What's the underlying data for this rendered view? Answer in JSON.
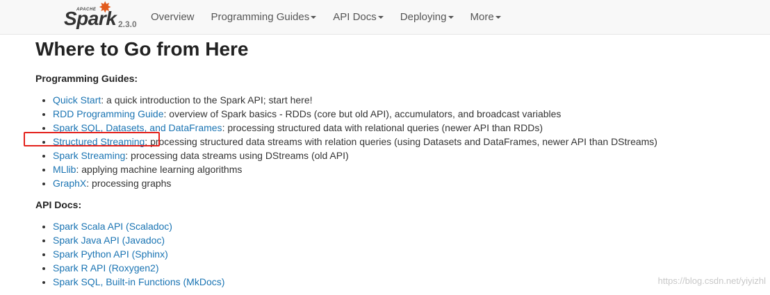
{
  "brand": {
    "apache": "APACHE",
    "name": "Spark",
    "version": "2.3.0"
  },
  "nav": {
    "items": [
      {
        "label": "Overview",
        "dropdown": false
      },
      {
        "label": "Programming Guides",
        "dropdown": true
      },
      {
        "label": "API Docs",
        "dropdown": true
      },
      {
        "label": "Deploying",
        "dropdown": true
      },
      {
        "label": "More",
        "dropdown": true
      }
    ]
  },
  "page": {
    "title": "Where to Go from Here",
    "programming_guides": {
      "heading": "Programming Guides:",
      "items": [
        {
          "link": "Quick Start",
          "desc": ": a quick introduction to the Spark API; start here!"
        },
        {
          "link": "RDD Programming Guide",
          "desc": ": overview of Spark basics - RDDs (core but old API), accumulators, and broadcast variables"
        },
        {
          "link": "Spark SQL, Datasets, and DataFrames",
          "desc": ": processing structured data with relational queries (newer API than RDDs)"
        },
        {
          "link": "Structured Streaming",
          "desc": ": processing structured data streams with relation queries (using Datasets and DataFrames, newer API than DStreams)"
        },
        {
          "link": "Spark Streaming",
          "desc": ": processing data streams using DStreams (old API)"
        },
        {
          "link": "MLlib",
          "desc": ": applying machine learning algorithms"
        },
        {
          "link": "GraphX",
          "desc": ": processing graphs"
        }
      ]
    },
    "api_docs": {
      "heading": "API Docs:",
      "items": [
        {
          "link": "Spark Scala API (Scaladoc)"
        },
        {
          "link": "Spark Java API (Javadoc)"
        },
        {
          "link": "Spark Python API (Sphinx)"
        },
        {
          "link": "Spark R API (Roxygen2)"
        },
        {
          "link": "Spark SQL, Built-in Functions (MkDocs)"
        }
      ]
    }
  },
  "watermark": "https://blog.csdn.net/yiyizhl",
  "colors": {
    "link": "#1a74b3",
    "highlight": "#e3201b",
    "brand_star": "#e25a1c"
  }
}
